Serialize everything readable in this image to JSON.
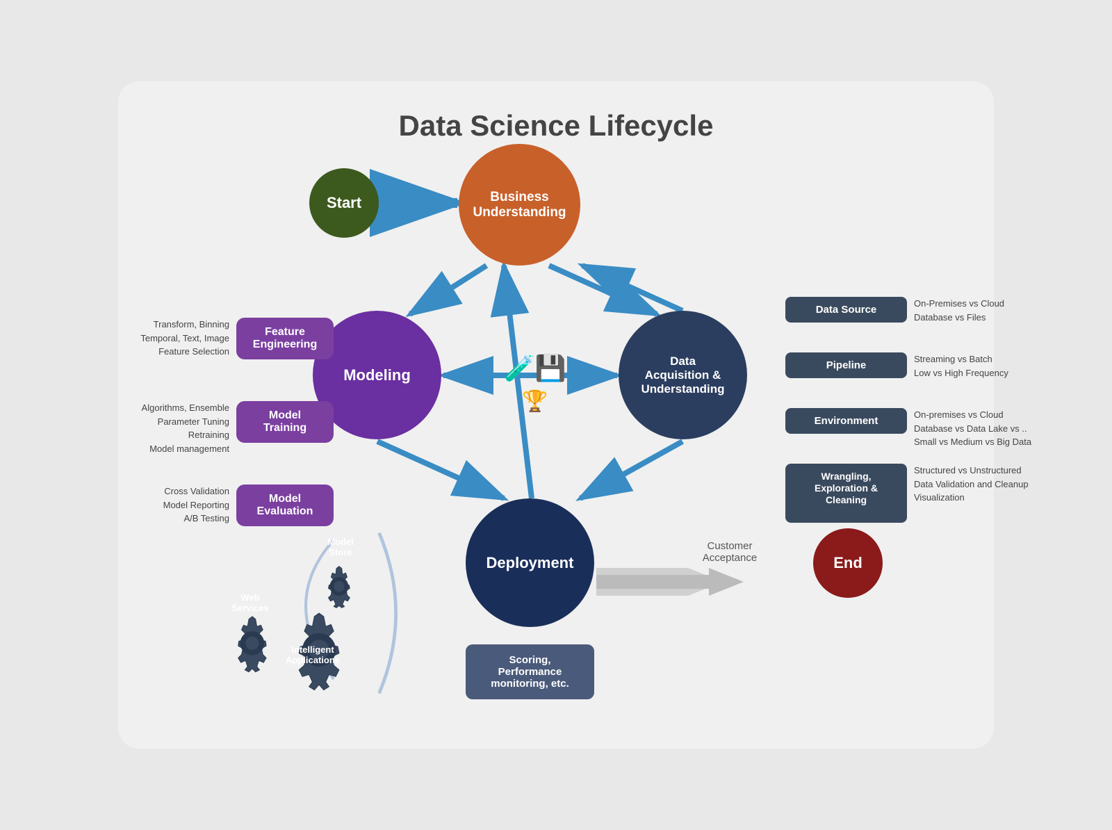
{
  "title": "Data Science Lifecycle",
  "nodes": {
    "start": "Start",
    "business_understanding": "Business\nUnderstanding",
    "modeling": "Modeling",
    "data_acquisition": "Data\nAcquisition &\nUnderstanding",
    "deployment": "Deployment",
    "end": "End"
  },
  "purple_boxes": {
    "feature_engineering": "Feature\nEngineering",
    "model_training": "Model\nTraining",
    "model_evaluation": "Model\nEvaluation"
  },
  "side_labels": {
    "feature": "Transform, Binning\nTemporal, Text, Image\nFeature Selection",
    "training": "Algorithms, Ensemble\nParameter Tuning\nRetraining\nModel management",
    "evaluation": "Cross Validation\nModel Reporting\nA/B Testing"
  },
  "right_boxes": {
    "data_source": "Data Source",
    "pipeline": "Pipeline",
    "environment": "Environment",
    "wrangling": "Wrangling,\nExploration &\nCleaning"
  },
  "right_texts": {
    "data_source": "On-Premises vs Cloud\nDatabase vs Files",
    "pipeline": "Streaming vs Batch\nLow vs High Frequency",
    "environment": "On-premises vs Cloud\nDatabase vs Data Lake vs ..\nSmall vs Medium vs Big Data",
    "wrangling": "Structured vs Unstructured\nData Validation and Cleanup\nVisualization"
  },
  "deploy_info": "Scoring,\nPerformance\nmonitoring, etc.",
  "customer_acceptance": "Customer\nAcceptance",
  "gear_labels": {
    "model_store": "Model\nStore",
    "web_services": "Web\nServices",
    "intelligent_apps": "Intelligent\nApplications"
  }
}
